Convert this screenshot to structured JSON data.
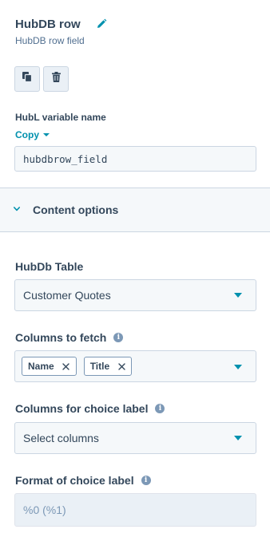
{
  "header": {
    "title": "HubDB row",
    "subtitle": "HubDB row field"
  },
  "actions": {
    "copy_icon": "copy-icon",
    "delete_icon": "trash-icon"
  },
  "hubl": {
    "label": "HubL variable name",
    "copy_label": "Copy",
    "value": "hubdbrow_field"
  },
  "content_options": {
    "title": "Content options",
    "expanded": true
  },
  "hubdb_table": {
    "label": "HubDb Table",
    "selected": "Customer Quotes"
  },
  "columns_to_fetch": {
    "label": "Columns to fetch",
    "tags": [
      {
        "label": "Name"
      },
      {
        "label": "Title"
      }
    ]
  },
  "choice_label_columns": {
    "label": "Columns for choice label",
    "placeholder": "Select columns"
  },
  "choice_label_format": {
    "label": "Format of choice label",
    "value": "%0 (%1)"
  },
  "colors": {
    "accent": "#0091ae",
    "text": "#33475b",
    "border": "#cbd6e2",
    "field_bg": "#f5f8fa"
  }
}
